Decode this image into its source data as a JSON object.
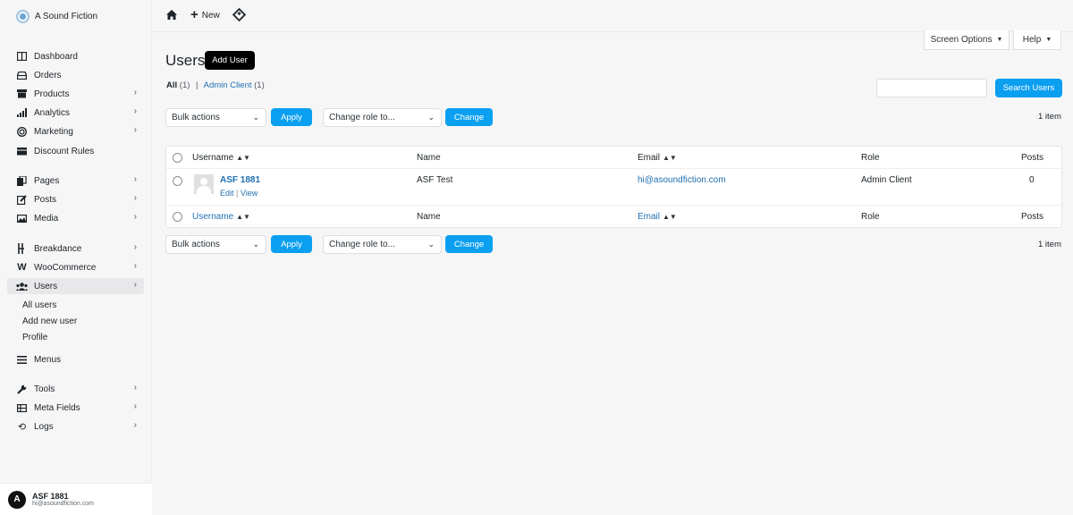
{
  "brand": {
    "name": "A Sound Fiction"
  },
  "sidebar": {
    "items": [
      {
        "label": "Dashboard",
        "icon": "dashboard-icon",
        "chevron": false
      },
      {
        "label": "Orders",
        "icon": "orders-icon",
        "chevron": false
      },
      {
        "label": "Products",
        "icon": "products-icon",
        "chevron": true
      },
      {
        "label": "Analytics",
        "icon": "analytics-icon",
        "chevron": true
      },
      {
        "label": "Marketing",
        "icon": "marketing-icon",
        "chevron": true
      },
      {
        "label": "Discount Rules",
        "icon": "discount-icon",
        "chevron": false
      },
      {
        "label": "Pages",
        "icon": "pages-icon",
        "chevron": true
      },
      {
        "label": "Posts",
        "icon": "posts-icon",
        "chevron": true
      },
      {
        "label": "Media",
        "icon": "media-icon",
        "chevron": true
      },
      {
        "label": "Breakdance",
        "icon": "breakdance-icon",
        "chevron": true
      },
      {
        "label": "WooCommerce",
        "icon": "woocommerce-icon",
        "chevron": true
      },
      {
        "label": "Users",
        "icon": "users-icon",
        "chevron": true,
        "active": true
      },
      {
        "label": "Menus",
        "icon": "menus-icon",
        "chevron": false
      },
      {
        "label": "Tools",
        "icon": "tools-icon",
        "chevron": true
      },
      {
        "label": "Meta Fields",
        "icon": "meta-fields-icon",
        "chevron": true
      },
      {
        "label": "Logs",
        "icon": "logs-icon",
        "chevron": true
      }
    ],
    "submenu": [
      "All users",
      "Add new user",
      "Profile"
    ]
  },
  "user": {
    "initial": "A",
    "name": "ASF 1881",
    "email": "hi@asoundfiction.com"
  },
  "topbar": {
    "new_label": "New"
  },
  "screen_options": {
    "label": "Screen Options",
    "help": "Help"
  },
  "page": {
    "title": "Users",
    "add_user": "Add User"
  },
  "filters": {
    "all_label": "All",
    "all_count": "(1)",
    "separator": "|",
    "admin_label": "Admin Client",
    "admin_count": "(1)"
  },
  "search": {
    "placeholder": "",
    "button": "Search Users"
  },
  "bulk": {
    "bulk_actions": "Bulk actions",
    "apply": "Apply",
    "change_role": "Change role to...",
    "change": "Change",
    "count": "1 item"
  },
  "table": {
    "columns": {
      "username": "Username",
      "name": "Name",
      "email": "Email",
      "role": "Role",
      "posts": "Posts"
    },
    "rows": [
      {
        "username": "ASF 1881",
        "edit": "Edit",
        "sep": "|",
        "view": "View",
        "name": "ASF Test",
        "email": "hi@asoundfiction.com",
        "role": "Admin Client",
        "posts": "0"
      }
    ]
  }
}
